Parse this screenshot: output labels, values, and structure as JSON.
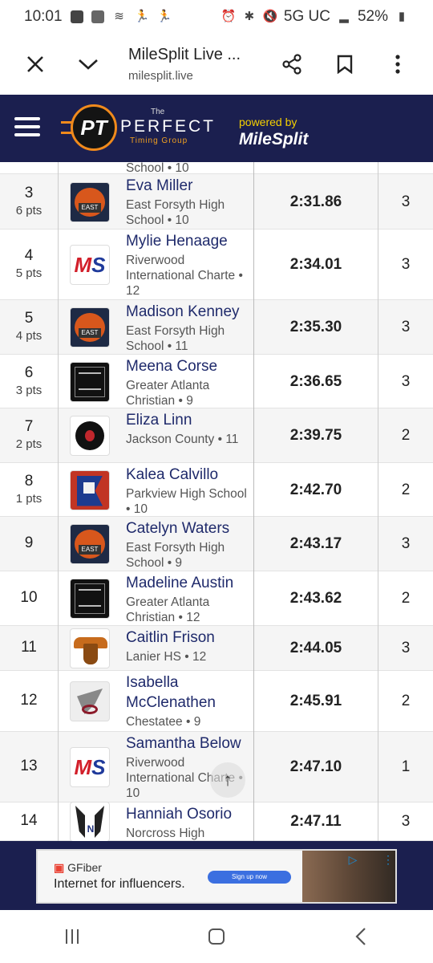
{
  "status_bar": {
    "time": "10:01",
    "network": "5G UC",
    "battery": "52%"
  },
  "browser": {
    "page_title": "MileSplit Live ...",
    "url": "milesplit.live"
  },
  "header": {
    "logo_initials": "PT",
    "logo_the": "The",
    "logo_perfect": "PERFECT",
    "logo_timing": "Timing Group",
    "powered_by": "powered by",
    "milesplit": "MileSplit"
  },
  "partial_row": {
    "school_tail": "School • 10"
  },
  "results": [
    {
      "place": "3",
      "points": "6 pts",
      "name": "Eva Miller",
      "school": "East Forsyth High School • 10",
      "time": "2:31.86",
      "heat": "3",
      "logo": "east-forsyth"
    },
    {
      "place": "4",
      "points": "5 pts",
      "name": "Mylie Henaage",
      "school": "Riverwood International Charte • 12",
      "time": "2:34.01",
      "heat": "3",
      "logo": "riverwood"
    },
    {
      "place": "5",
      "points": "4 pts",
      "name": "Madison Kenney",
      "school": "East Forsyth High School • 11",
      "time": "2:35.30",
      "heat": "3",
      "logo": "east-forsyth"
    },
    {
      "place": "6",
      "points": "3 pts",
      "name": "Meena Corse",
      "school": "Greater Atlanta Christian • 9",
      "time": "2:36.65",
      "heat": "3",
      "logo": "greater-atlanta"
    },
    {
      "place": "7",
      "points": "2 pts",
      "name": "Eliza Linn",
      "school": "Jackson County • 11",
      "time": "2:39.75",
      "heat": "2",
      "logo": "jackson-county"
    },
    {
      "place": "8",
      "points": "1 pts",
      "name": "Kalea Calvillo",
      "school": "Parkview High School • 10",
      "time": "2:42.70",
      "heat": "2",
      "logo": "parkview"
    },
    {
      "place": "9",
      "points": "",
      "name": "Catelyn Waters",
      "school": "East Forsyth High School • 9",
      "time": "2:43.17",
      "heat": "3",
      "logo": "east-forsyth"
    },
    {
      "place": "10",
      "points": "",
      "name": "Madeline Austin",
      "school": "Greater Atlanta Christian • 12",
      "time": "2:43.62",
      "heat": "2",
      "logo": "greater-atlanta"
    },
    {
      "place": "11",
      "points": "",
      "name": "Caitlin Frison",
      "school": "Lanier HS • 12",
      "time": "2:44.05",
      "heat": "3",
      "logo": "lanier"
    },
    {
      "place": "12",
      "points": "",
      "name": "Isabella McClenathen",
      "school": "Chestatee • 9",
      "time": "2:45.91",
      "heat": "2",
      "logo": "chestatee"
    },
    {
      "place": "13",
      "points": "",
      "name": "Samantha Below",
      "school": "Riverwood International Charte • 10",
      "time": "2:47.10",
      "heat": "1",
      "logo": "riverwood"
    },
    {
      "place": "14",
      "points": "",
      "name": "Hanniah Osorio",
      "school": "Norcross High",
      "time": "2:47.11",
      "heat": "3",
      "logo": "norcross"
    }
  ],
  "ad": {
    "brand": "GFiber",
    "text": "Internet for influencers.",
    "button": "Sign up now"
  },
  "icons": {
    "close": "close-icon",
    "chevron": "chevron-down-icon",
    "share": "share-icon",
    "bookmark": "bookmark-icon",
    "more": "more-vert-icon",
    "menu": "menu-icon",
    "scroll_top": "arrow-up-icon",
    "recents": "recents-icon",
    "home": "home-icon",
    "back": "back-icon"
  },
  "colors": {
    "header_bg": "#1b1f4f",
    "athlete_name": "#1f2a6b",
    "accent_orange": "#f08a1c",
    "powered_yellow": "#f5d000"
  }
}
